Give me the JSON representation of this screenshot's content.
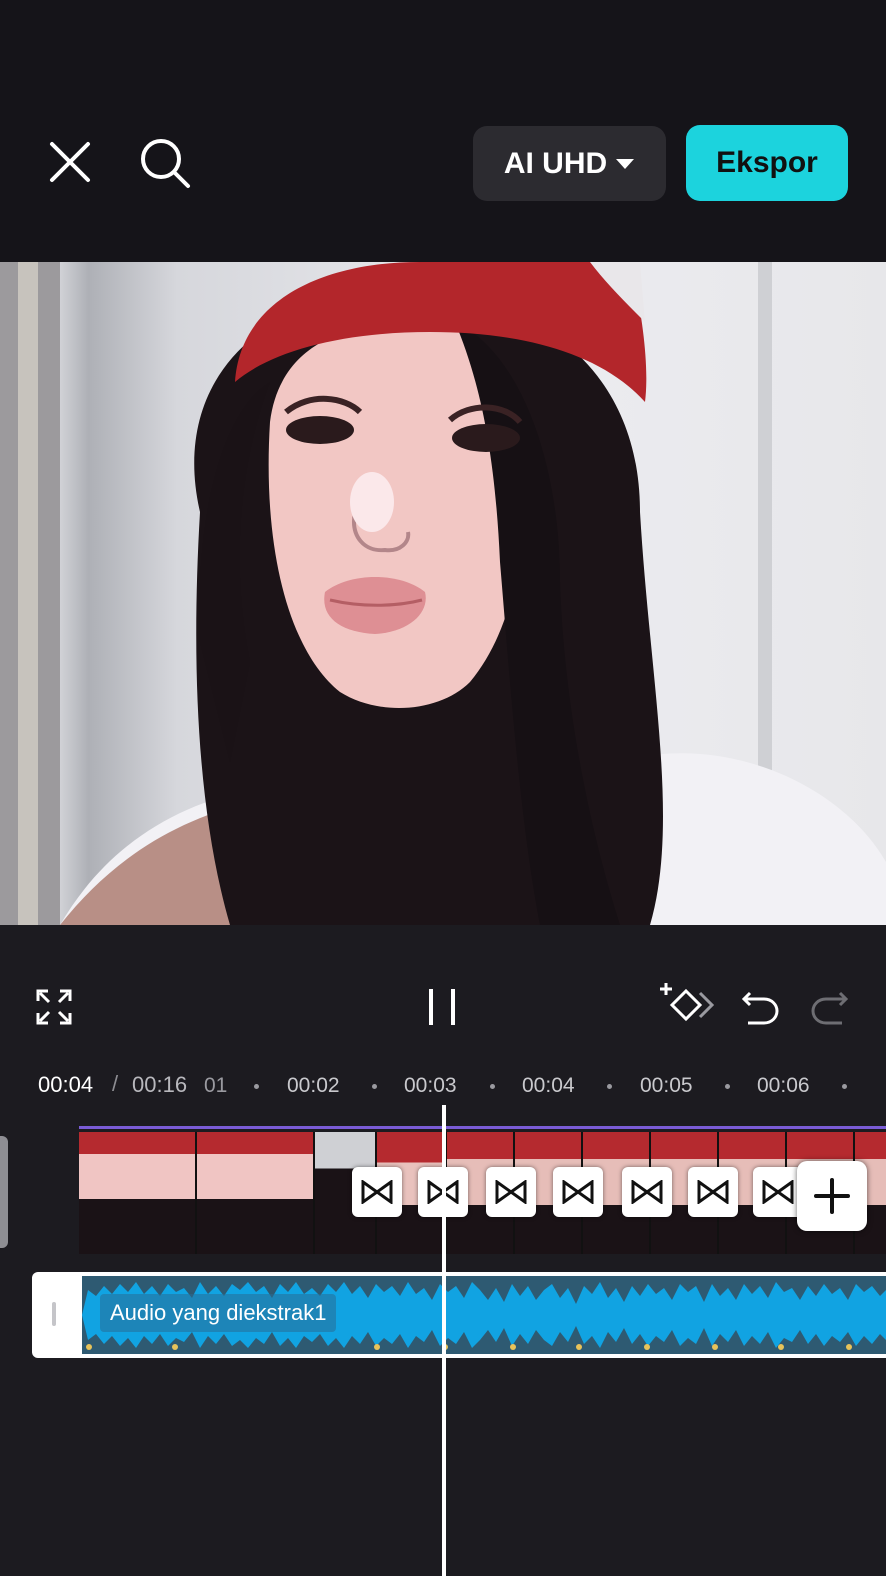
{
  "topbar": {
    "close_icon": "close-icon",
    "search_icon": "search-icon",
    "quality_label": "AI UHD",
    "export_label": "Ekspor"
  },
  "colors": {
    "accent": "#1cd3dd",
    "background": "#1c1b20",
    "audio_wave": "#11a3e2",
    "audio_track_bg": "#2e5a72"
  },
  "controls": {
    "fullscreen_icon": "fullscreen-icon",
    "pause_icon": "pause-icon",
    "keyframe_icon": "add-keyframe-icon",
    "undo_icon": "undo-icon",
    "redo_icon": "redo-icon"
  },
  "timeline": {
    "current_time": "00:04",
    "separator": "/",
    "total_time": "00:16",
    "ruler_labels": [
      "01",
      "00:02",
      "00:03",
      "00:04",
      "00:05",
      "00:06"
    ]
  },
  "audio": {
    "label": "Audio yang diekstrak1"
  }
}
